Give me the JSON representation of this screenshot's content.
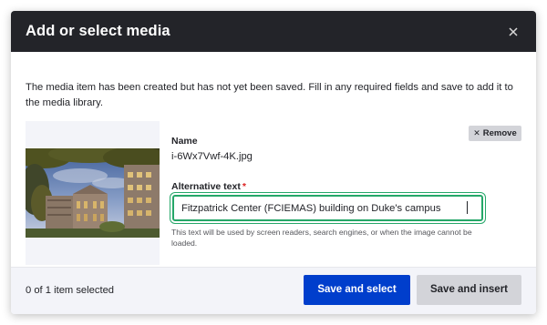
{
  "dialog": {
    "title": "Add or select media",
    "close_icon": "close-icon"
  },
  "message": "The media item has been created but has not yet been saved. Fill in any required fields and save to add it to the media library.",
  "media": {
    "name_label": "Name",
    "name_value": "i-6Wx7Vwf-4K.jpg",
    "remove_label": "Remove",
    "remove_icon": "close-icon",
    "thumbnail_icon": "building-photo"
  },
  "alt_text": {
    "label": "Alternative text",
    "required_marker": "*",
    "value": "Fitzpatrick Center (FCIEMAS) building on Duke's campus",
    "help": "This text will be used by screen readers, search engines, or when the image cannot be loaded."
  },
  "footer": {
    "selected_count": "0 of 1 item selected",
    "save_select_label": "Save and select",
    "save_insert_label": "Save and insert"
  },
  "colors": {
    "titlebar": "#232429",
    "primary_button": "#003ecc",
    "secondary_button": "#d3d4d9",
    "focus_border": "#26a769",
    "required": "#dc2323",
    "footer_bg": "#f3f4f9"
  }
}
